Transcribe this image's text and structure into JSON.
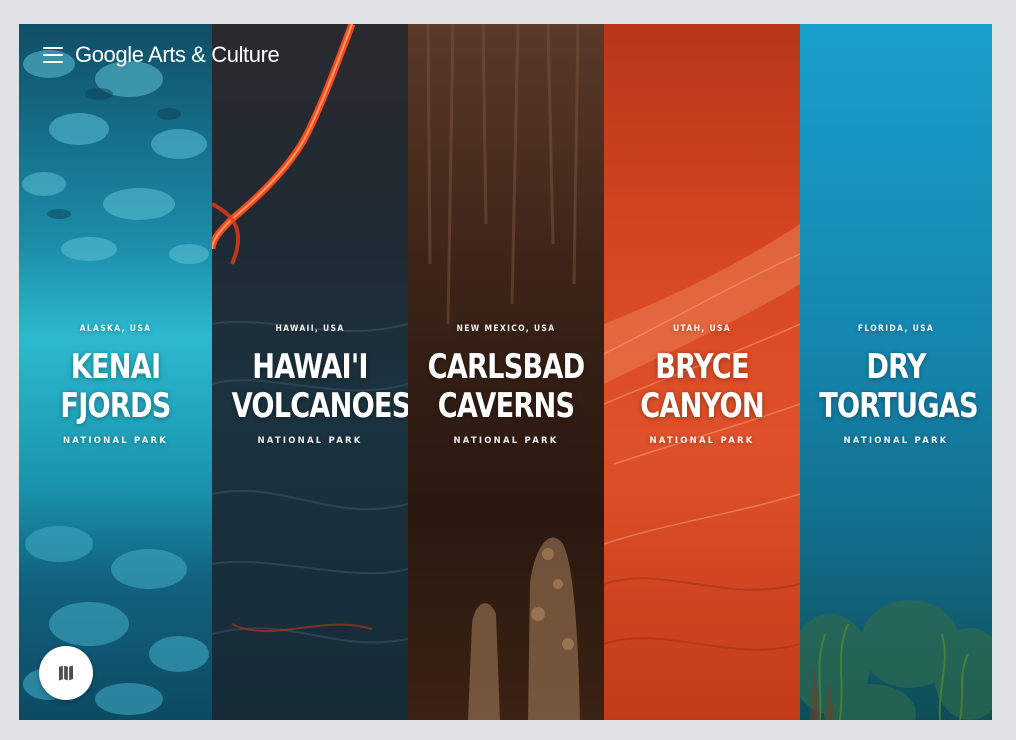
{
  "header": {
    "brand": "Google Arts & Culture",
    "menu_icon": "menu-icon"
  },
  "map_button": {
    "icon": "map-icon"
  },
  "parks": [
    {
      "region": "ALASKA, USA",
      "name_line1": "KENAI",
      "name_line2": "FJORDS",
      "suffix": "NATIONAL PARK",
      "color": "#1f9db7"
    },
    {
      "region": "HAWAII, USA",
      "name_line1": "HAWAI'I",
      "name_line2": "VOLCANOES",
      "suffix": "NATIONAL PARK",
      "color": "#23313b"
    },
    {
      "region": "NEW MEXICO, USA",
      "name_line1": "CARLSBAD",
      "name_line2": "CAVERNS",
      "suffix": "NATIONAL PARK",
      "color": "#4a2a1b"
    },
    {
      "region": "UTAH, USA",
      "name_line1": "BRYCE",
      "name_line2": "CANYON",
      "suffix": "NATIONAL PARK",
      "color": "#d8431c"
    },
    {
      "region": "FLORIDA, USA",
      "name_line1": "DRY",
      "name_line2": "TORTUGAS",
      "suffix": "NATIONAL PARK",
      "color": "#1788ad"
    }
  ]
}
